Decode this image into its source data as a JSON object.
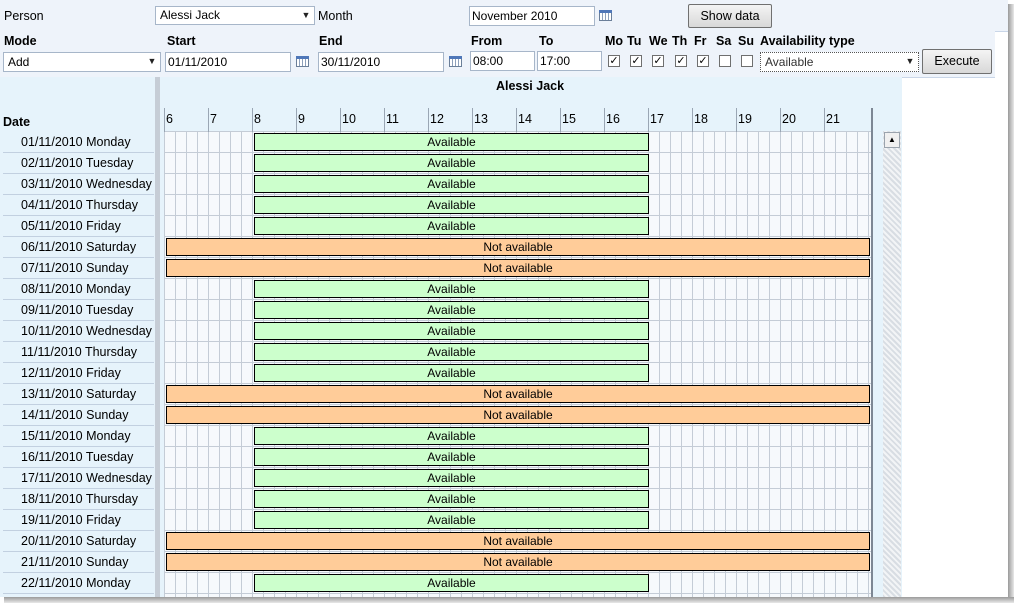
{
  "header": {
    "person_label": "Person",
    "person_value": "Alessi Jack",
    "month_label": "Month",
    "month_value": "November 2010",
    "show_data_label": "Show data"
  },
  "form": {
    "mode_label": "Mode",
    "mode_value": "Add",
    "start_label": "Start",
    "start_value": "01/11/2010",
    "end_label": "End",
    "end_value": "30/11/2010",
    "from_label": "From",
    "from_value": "08:00",
    "to_label": "To",
    "to_value": "17:00",
    "days": [
      {
        "label": "Mo",
        "checked": true
      },
      {
        "label": "Tu",
        "checked": true
      },
      {
        "label": "We",
        "checked": true
      },
      {
        "label": "Th",
        "checked": true
      },
      {
        "label": "Fr",
        "checked": true
      },
      {
        "label": "Sa",
        "checked": false
      },
      {
        "label": "Su",
        "checked": false
      }
    ],
    "availability_type_label": "Availability type",
    "availability_type_value": "Available",
    "execute_label": "Execute"
  },
  "schedule": {
    "person_title": "Alessi Jack",
    "date_header": "Date",
    "hours": [
      "6",
      "7",
      "8",
      "9",
      "10",
      "11",
      "12",
      "13",
      "14",
      "15",
      "16",
      "17",
      "18",
      "19",
      "20",
      "21"
    ],
    "rows": [
      {
        "date": "01/11/2010 Monday",
        "status": "Available"
      },
      {
        "date": "02/11/2010 Tuesday",
        "status": "Available"
      },
      {
        "date": "03/11/2010 Wednesday",
        "status": "Available"
      },
      {
        "date": "04/11/2010 Thursday",
        "status": "Available"
      },
      {
        "date": "05/11/2010 Friday",
        "status": "Available"
      },
      {
        "date": "06/11/2010 Saturday",
        "status": "Not available"
      },
      {
        "date": "07/11/2010 Sunday",
        "status": "Not available"
      },
      {
        "date": "08/11/2010 Monday",
        "status": "Available"
      },
      {
        "date": "09/11/2010 Tuesday",
        "status": "Available"
      },
      {
        "date": "10/11/2010 Wednesday",
        "status": "Available"
      },
      {
        "date": "11/11/2010 Thursday",
        "status": "Available"
      },
      {
        "date": "12/11/2010 Friday",
        "status": "Available"
      },
      {
        "date": "13/11/2010 Saturday",
        "status": "Not available"
      },
      {
        "date": "14/11/2010 Sunday",
        "status": "Not available"
      },
      {
        "date": "15/11/2010 Monday",
        "status": "Available"
      },
      {
        "date": "16/11/2010 Tuesday",
        "status": "Available"
      },
      {
        "date": "17/11/2010 Wednesday",
        "status": "Available"
      },
      {
        "date": "18/11/2010 Thursday",
        "status": "Available"
      },
      {
        "date": "19/11/2010 Friday",
        "status": "Available"
      },
      {
        "date": "20/11/2010 Saturday",
        "status": "Not available"
      },
      {
        "date": "21/11/2010 Sunday",
        "status": "Not available"
      },
      {
        "date": "22/11/2010 Monday",
        "status": "Available"
      }
    ]
  },
  "colors": {
    "available": "#ccffcc",
    "not_available": "#ffcc99"
  }
}
